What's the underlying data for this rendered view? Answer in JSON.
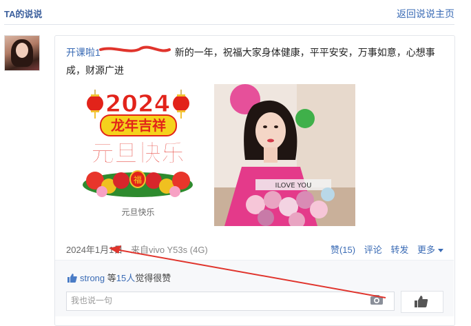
{
  "header": {
    "title": "TA的说说",
    "back_label": "返回说说主页"
  },
  "post": {
    "author": "开课啦1",
    "text": "新的一年，祝福大家身体健康，平平安安，万事如意，心想事成，财源广进",
    "image1": {
      "year": "2024",
      "line1": "龙年吉祥",
      "line2": "元旦快乐",
      "badge": "福",
      "caption": "元旦快乐"
    },
    "image2": {
      "banner": "ILOVE YOU"
    },
    "date": "2024年1月1日",
    "device": "来自vivo Y53s (4G)",
    "actions": {
      "like": "赞(15)",
      "comment": "评论",
      "forward": "转发",
      "more": "更多"
    }
  },
  "likes": {
    "name": "strong",
    "middle": "等",
    "count": "15人",
    "suffix": "觉得很赞"
  },
  "comment": {
    "placeholder": "我也说一句"
  },
  "colors": {
    "link": "#3a6bb5",
    "annotation": "#e0342c",
    "card_border": "#e3e6eb"
  }
}
